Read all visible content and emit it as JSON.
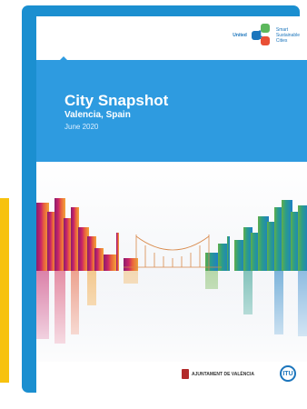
{
  "cover": {
    "title": "City Snapshot",
    "subtitle": "Valencia, Spain",
    "date": "June 2020"
  },
  "logos": {
    "u4ssc_united": "United",
    "u4ssc_number": "4",
    "u4ssc_smart": "Smart",
    "u4ssc_sustainable": "Sustainable",
    "u4ssc_cities": "Cities",
    "ajuntament": "AJUNTAMENT DE VALÈNCIA",
    "itu": "ITU"
  },
  "colors": {
    "accent_blue": "#2e9be0",
    "frame_blue": "#1b8fd0",
    "side_tab_yellow": "#f7c20e"
  }
}
